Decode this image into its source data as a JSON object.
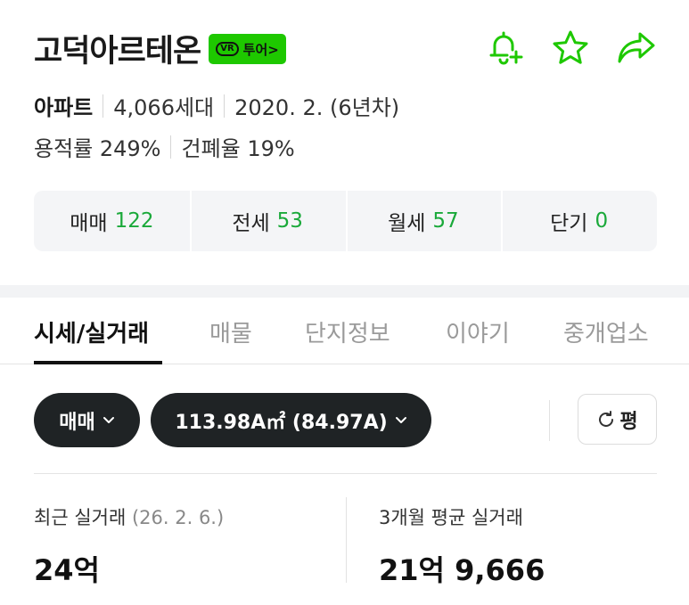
{
  "header": {
    "title": "고덕아르테온",
    "badge_vr": "VR",
    "badge_label": "투어>",
    "icons": [
      "bell-plus-icon",
      "star-icon",
      "share-icon"
    ],
    "accent_color": "#1ec800"
  },
  "info": {
    "type": "아파트",
    "households": "4,066세대",
    "built": "2020. 2. (6년차)",
    "far": "용적률 249%",
    "bcr": "건폐율 19%"
  },
  "counts": [
    {
      "label": "매매",
      "value": "122"
    },
    {
      "label": "전세",
      "value": "53"
    },
    {
      "label": "월세",
      "value": "57"
    },
    {
      "label": "단기",
      "value": "0"
    }
  ],
  "tabs": [
    "시세/실거래",
    "매물",
    "단지정보",
    "이야기",
    "중개업소"
  ],
  "filters": {
    "deal_type": "매매",
    "area": "113.98A㎡ (84.97A)",
    "unit_toggle": "평"
  },
  "stats": {
    "recent_label": "최근 실거래",
    "recent_date": "(26. 2. 6.)",
    "recent_value": "24억",
    "avg_label": "3개월 평균 실거래",
    "avg_value": "21억 9,666"
  }
}
